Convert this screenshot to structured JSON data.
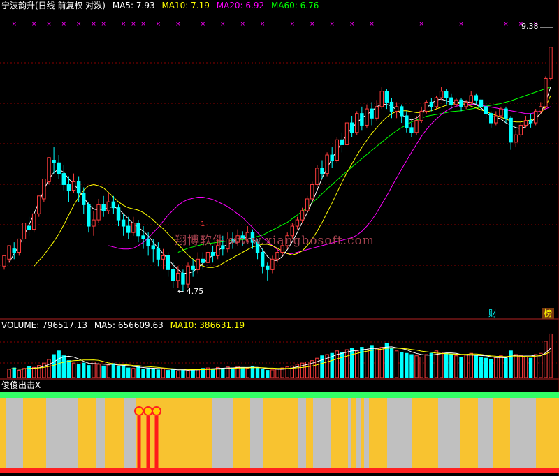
{
  "header": {
    "stock_title": "宁波韵升(日线 前复权 对数)",
    "ma5_label": "MA5: 7.93",
    "ma10_label": "MA10: 7.19",
    "ma20_label": "MA20: 6.92",
    "ma60_label": "MA60: 6.76"
  },
  "annotations": {
    "low_price_label": "← 4.75",
    "high_price_label": "9.38",
    "peak_marker": "1",
    "finance_badge": "财",
    "ranking_badge": "榜"
  },
  "volume_header": {
    "volume_label": "VOLUME: 796517.13",
    "ma5_label": "MA5: 656609.63",
    "ma10_label": "MA10: 386631.19"
  },
  "indicator_header": {
    "title": "俊俊出击X"
  },
  "watermark": "翔博软件 www.xiangbosoft.com",
  "colors": {
    "up": "#ff3c3c",
    "down": "#00ffff",
    "ma5": "#ffffff",
    "ma10": "#ffff00",
    "ma20": "#ff00ff",
    "ma60": "#00ff00",
    "band_yellow": "#f8c330",
    "band_gray": "#c0c0c0",
    "band_green": "#33ff66",
    "signal_red": "#ff1a1a",
    "grid": "#8b0000"
  },
  "chart_data": {
    "type": "candlestick",
    "scale": "log",
    "candles": [
      [
        5.1,
        5.25,
        5.05,
        5.2
      ],
      [
        5.2,
        5.4,
        5.15,
        5.35
      ],
      [
        5.35,
        5.3,
        5.2,
        5.45
      ],
      [
        5.3,
        5.5,
        5.25,
        5.48
      ],
      [
        5.5,
        5.75,
        5.45,
        5.7
      ],
      [
        5.7,
        5.65,
        5.55,
        5.85
      ],
      [
        5.65,
        5.9,
        5.6,
        5.88
      ],
      [
        5.9,
        6.2,
        5.85,
        6.15
      ],
      [
        6.15,
        6.5,
        6.1,
        6.45
      ],
      [
        6.45,
        6.9,
        6.4,
        6.85
      ],
      [
        6.85,
        6.8,
        6.6,
        7.1
      ],
      [
        6.8,
        6.6,
        6.5,
        6.95
      ],
      [
        6.6,
        6.4,
        6.3,
        6.75
      ],
      [
        6.4,
        6.3,
        6.1,
        6.55
      ],
      [
        6.3,
        6.45,
        6.25,
        6.6
      ],
      [
        6.45,
        6.25,
        6.1,
        6.55
      ],
      [
        6.25,
        6.05,
        5.9,
        6.35
      ],
      [
        6.05,
        5.7,
        5.6,
        6.1
      ],
      [
        5.7,
        5.8,
        5.55,
        5.95
      ],
      [
        5.8,
        6.05,
        5.75,
        6.15
      ],
      [
        6.05,
        5.95,
        5.85,
        6.2
      ],
      [
        5.95,
        6.1,
        5.9,
        6.25
      ],
      [
        6.1,
        6.0,
        5.9,
        6.2
      ],
      [
        6.0,
        5.8,
        5.7,
        6.05
      ],
      [
        5.8,
        5.7,
        5.55,
        5.9
      ],
      [
        5.7,
        5.6,
        5.5,
        5.85
      ],
      [
        5.6,
        5.75,
        5.55,
        5.85
      ],
      [
        5.75,
        5.55,
        5.45,
        5.8
      ],
      [
        5.55,
        5.5,
        5.35,
        5.7
      ],
      [
        5.5,
        5.4,
        5.25,
        5.6
      ],
      [
        5.4,
        5.35,
        5.15,
        5.5
      ],
      [
        5.35,
        5.2,
        5.1,
        5.45
      ],
      [
        5.2,
        5.25,
        5.05,
        5.35
      ],
      [
        5.25,
        5.05,
        4.95,
        5.3
      ],
      [
        5.05,
        4.9,
        4.8,
        5.15
      ],
      [
        4.9,
        5.0,
        4.8,
        5.1
      ],
      [
        5.0,
        4.85,
        4.75,
        5.05
      ],
      [
        4.85,
        5.1,
        4.8,
        5.15
      ],
      [
        5.1,
        5.05,
        4.95,
        5.2
      ],
      [
        5.05,
        5.2,
        5.0,
        5.3
      ],
      [
        5.2,
        5.15,
        5.05,
        5.3
      ],
      [
        5.15,
        5.3,
        5.1,
        5.4
      ],
      [
        5.3,
        5.25,
        5.15,
        5.4
      ],
      [
        5.25,
        5.4,
        5.2,
        5.5
      ],
      [
        5.4,
        5.35,
        5.25,
        5.55
      ],
      [
        5.35,
        5.5,
        5.3,
        5.6
      ],
      [
        5.5,
        5.45,
        5.35,
        5.6
      ],
      [
        5.45,
        5.55,
        5.4,
        5.65
      ],
      [
        5.55,
        5.5,
        5.4,
        5.62
      ],
      [
        5.5,
        5.6,
        5.45,
        5.7
      ],
      [
        5.6,
        5.45,
        5.35,
        5.65
      ],
      [
        5.45,
        5.3,
        5.2,
        5.5
      ],
      [
        5.3,
        5.1,
        5.0,
        5.35
      ],
      [
        5.1,
        5.05,
        4.9,
        5.15
      ],
      [
        5.05,
        5.2,
        5.0,
        5.25
      ],
      [
        5.2,
        5.3,
        5.15,
        5.35
      ],
      [
        5.3,
        5.4,
        5.25,
        5.45
      ],
      [
        5.4,
        5.55,
        5.35,
        5.6
      ],
      [
        5.55,
        5.7,
        5.5,
        5.75
      ],
      [
        5.7,
        5.8,
        5.65,
        5.85
      ],
      [
        5.8,
        5.95,
        5.75,
        6.0
      ],
      [
        5.95,
        6.15,
        5.9,
        6.2
      ],
      [
        6.15,
        6.4,
        6.1,
        6.45
      ],
      [
        6.4,
        6.7,
        6.35,
        6.75
      ],
      [
        6.7,
        6.6,
        6.5,
        6.85
      ],
      [
        6.6,
        6.95,
        6.55,
        7.0
      ],
      [
        6.95,
        6.85,
        6.7,
        7.1
      ],
      [
        6.85,
        7.25,
        6.8,
        7.3
      ],
      [
        7.25,
        7.15,
        7.0,
        7.4
      ],
      [
        7.15,
        7.6,
        7.1,
        7.65
      ],
      [
        7.6,
        7.4,
        7.3,
        7.75
      ],
      [
        7.4,
        7.8,
        7.35,
        7.85
      ],
      [
        7.8,
        7.55,
        7.45,
        7.95
      ],
      [
        7.55,
        7.9,
        7.5,
        8.0
      ],
      [
        7.9,
        7.7,
        7.55,
        8.05
      ],
      [
        7.7,
        7.95,
        7.65,
        8.1
      ],
      [
        7.95,
        8.3,
        7.9,
        8.4
      ],
      [
        8.3,
        8.05,
        7.9,
        8.35
      ],
      [
        8.05,
        7.85,
        7.7,
        8.15
      ],
      [
        7.85,
        7.95,
        7.7,
        8.05
      ],
      [
        7.95,
        7.75,
        7.6,
        8.0
      ],
      [
        7.75,
        7.5,
        7.4,
        7.85
      ],
      [
        7.5,
        7.4,
        7.3,
        7.6
      ],
      [
        7.4,
        7.65,
        7.35,
        7.75
      ],
      [
        7.65,
        7.85,
        7.6,
        7.95
      ],
      [
        7.85,
        8.05,
        7.8,
        8.1
      ],
      [
        8.05,
        7.95,
        7.85,
        8.15
      ],
      [
        7.95,
        8.15,
        7.9,
        8.2
      ],
      [
        8.15,
        8.3,
        8.1,
        8.4
      ],
      [
        8.3,
        8.15,
        8.0,
        8.35
      ],
      [
        8.15,
        8.0,
        7.9,
        8.25
      ],
      [
        8.0,
        8.1,
        7.95,
        8.15
      ],
      [
        8.1,
        7.95,
        7.85,
        8.15
      ],
      [
        7.95,
        8.05,
        7.9,
        8.1
      ],
      [
        8.05,
        8.2,
        8.0,
        8.3
      ],
      [
        8.2,
        8.1,
        8.0,
        8.25
      ],
      [
        8.1,
        7.95,
        7.85,
        8.15
      ],
      [
        7.95,
        7.8,
        7.7,
        8.0
      ],
      [
        7.8,
        7.6,
        7.5,
        7.85
      ],
      [
        7.6,
        7.75,
        7.55,
        7.85
      ],
      [
        7.75,
        7.9,
        7.7,
        7.95
      ],
      [
        7.9,
        7.7,
        7.6,
        7.95
      ],
      [
        7.7,
        7.2,
        7.05,
        7.75
      ],
      [
        7.2,
        7.35,
        7.1,
        7.45
      ],
      [
        7.35,
        7.55,
        7.3,
        7.65
      ],
      [
        7.55,
        7.65,
        7.5,
        7.75
      ],
      [
        7.65,
        7.6,
        7.5,
        7.8
      ],
      [
        7.6,
        7.85,
        7.55,
        7.9
      ],
      [
        7.85,
        7.95,
        7.8,
        8.05
      ],
      [
        7.95,
        8.6,
        7.9,
        8.65
      ],
      [
        8.6,
        9.38,
        8.55,
        9.38
      ]
    ],
    "ma5": [
      5.15,
      5.28,
      5.4,
      5.55,
      5.72,
      5.9,
      6.1,
      6.3,
      6.5,
      6.62,
      6.68,
      6.62,
      6.5,
      6.42,
      6.3,
      6.18,
      6.05,
      5.98,
      5.96,
      5.98,
      6.0,
      6.02,
      5.98,
      5.9,
      5.82,
      5.74,
      5.68,
      5.62,
      5.55,
      5.45,
      5.36,
      5.28,
      5.2,
      5.12,
      5.05,
      5.0,
      5.0,
      5.02,
      5.08,
      5.14,
      5.2,
      5.26,
      5.32,
      5.38,
      5.42,
      5.46,
      5.5,
      5.52,
      5.52,
      5.5,
      5.44,
      5.34,
      5.24,
      5.18,
      5.18,
      5.24,
      5.34,
      5.46,
      5.6,
      5.76,
      5.92,
      6.1,
      6.3,
      6.52,
      6.7,
      6.88,
      7.04,
      7.2,
      7.36,
      7.5,
      7.6,
      7.7,
      7.78,
      7.85,
      7.95,
      8.0,
      8.0,
      7.96,
      7.88,
      7.78,
      7.7,
      7.66,
      7.7,
      7.8,
      7.92,
      8.02,
      8.1,
      8.12,
      8.08,
      8.05,
      8.04,
      8.06,
      8.06,
      8.04,
      8.0,
      7.92,
      7.82,
      7.74,
      7.72,
      7.68,
      7.6,
      7.55,
      7.5,
      7.48,
      7.52,
      7.62,
      7.7,
      7.8,
      8.05,
      8.4
    ],
    "ma10": [
      5.1,
      5.18,
      5.26,
      5.36,
      5.46,
      5.58,
      5.72,
      5.88,
      6.04,
      6.18,
      6.3,
      6.38,
      6.4,
      6.38,
      6.34,
      6.26,
      6.18,
      6.1,
      6.04,
      6.0,
      5.98,
      5.96,
      5.92,
      5.86,
      5.8,
      5.72,
      5.66,
      5.58,
      5.5,
      5.42,
      5.34,
      5.26,
      5.2,
      5.14,
      5.1,
      5.08,
      5.08,
      5.1,
      5.14,
      5.18,
      5.22,
      5.26,
      5.3,
      5.34,
      5.38,
      5.4,
      5.42,
      5.42,
      5.4,
      5.36,
      5.32,
      5.28,
      5.26,
      5.28,
      5.32,
      5.4,
      5.5,
      5.62,
      5.76,
      5.92,
      6.08,
      6.26,
      6.44,
      6.62,
      6.78,
      6.94,
      7.1,
      7.24,
      7.38,
      7.5,
      7.62,
      7.72,
      7.8,
      7.84,
      7.86,
      7.86,
      7.84,
      7.82,
      7.82,
      7.84,
      7.86,
      7.9,
      7.94,
      7.98,
      8.0,
      8.02,
      8.02,
      8.0,
      7.96,
      7.92,
      7.88,
      7.84,
      7.8,
      7.76,
      7.72,
      7.68,
      7.64,
      7.62,
      7.62,
      7.64,
      7.66,
      7.7,
      7.8,
      7.95,
      8.2
    ],
    "ma20": [
      5.4,
      5.38,
      5.36,
      5.35,
      5.35,
      5.36,
      5.4,
      5.45,
      5.52,
      5.6,
      5.68,
      5.78,
      5.88,
      5.96,
      6.04,
      6.1,
      6.14,
      6.16,
      6.18,
      6.18,
      6.16,
      6.14,
      6.1,
      6.06,
      6.02,
      5.96,
      5.9,
      5.84,
      5.76,
      5.68,
      5.6,
      5.52,
      5.46,
      5.4,
      5.34,
      5.3,
      5.28,
      5.28,
      5.3,
      5.32,
      5.34,
      5.36,
      5.38,
      5.4,
      5.42,
      5.44,
      5.46,
      5.48,
      5.5,
      5.52,
      5.56,
      5.62,
      5.7,
      5.8,
      5.92,
      6.06,
      6.2,
      6.36,
      6.52,
      6.68,
      6.84,
      7.0,
      7.16,
      7.32,
      7.46,
      7.58,
      7.68,
      7.78,
      7.86,
      7.92,
      7.96,
      7.98,
      8.0,
      8.0,
      8.0,
      7.98,
      7.96,
      7.94,
      7.92,
      7.9,
      7.88,
      7.86,
      7.84,
      7.82,
      7.8,
      7.8,
      7.82,
      7.86,
      7.9,
      7.95
    ],
    "ma60": [
      5.3,
      5.33,
      5.36,
      5.38,
      5.4,
      5.42,
      5.43,
      5.44,
      5.45,
      5.46,
      5.47,
      5.48,
      5.48,
      5.49,
      5.5,
      5.52,
      5.54,
      5.56,
      5.6,
      5.64,
      5.68,
      5.72,
      5.76,
      5.82,
      5.88,
      5.94,
      6.0,
      6.08,
      6.16,
      6.24,
      6.32,
      6.4,
      6.48,
      6.56,
      6.64,
      6.72,
      6.8,
      6.88,
      6.96,
      7.04,
      7.12,
      7.2,
      7.28,
      7.36,
      7.44,
      7.5,
      7.56,
      7.62,
      7.66,
      7.7,
      7.74,
      7.76,
      7.78,
      7.8,
      7.82,
      7.84,
      7.85,
      7.86,
      7.88,
      7.9,
      7.92,
      7.94,
      7.96,
      7.98,
      8.0,
      8.02,
      8.05,
      8.08,
      8.12,
      8.16,
      8.2,
      8.24,
      8.28,
      8.32,
      8.36,
      8.4
    ],
    "volumes": [
      35,
      40,
      30,
      38,
      45,
      42,
      50,
      60,
      75,
      95,
      110,
      90,
      70,
      60,
      55,
      60,
      50,
      65,
      55,
      48,
      52,
      58,
      45,
      50,
      40,
      38,
      45,
      35,
      40,
      36,
      32,
      38,
      30,
      34,
      28,
      32,
      30,
      36,
      34,
      38,
      40,
      36,
      42,
      38,
      44,
      40,
      46,
      42,
      38,
      45,
      40,
      35,
      30,
      32,
      36,
      40,
      44,
      48,
      55,
      60,
      65,
      70,
      80,
      90,
      95,
      100,
      110,
      105,
      115,
      120,
      110,
      125,
      115,
      130,
      120,
      125,
      140,
      120,
      110,
      105,
      100,
      95,
      90,
      85,
      95,
      100,
      110,
      105,
      100,
      95,
      90,
      85,
      95,
      100,
      90,
      85,
      80,
      75,
      85,
      90,
      80,
      110,
      95,
      90,
      85,
      80,
      95,
      100,
      150,
      180
    ]
  }
}
